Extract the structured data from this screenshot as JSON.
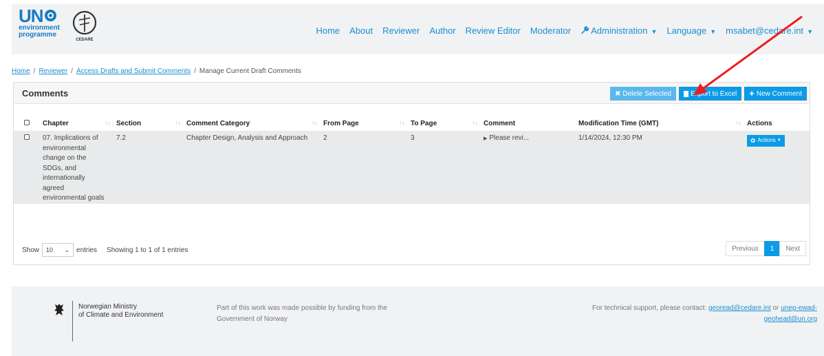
{
  "header": {
    "logo": {
      "un": "UN",
      "line1": "environment",
      "line2": "programme",
      "cedare": "CEDARE"
    },
    "nav": [
      {
        "label": "Home"
      },
      {
        "label": "About"
      },
      {
        "label": "Reviewer"
      },
      {
        "label": "Author"
      },
      {
        "label": "Review Editor"
      },
      {
        "label": "Moderator"
      },
      {
        "label": "Administration",
        "icon": "wrench-icon",
        "dropdown": true
      },
      {
        "label": "Language",
        "dropdown": true
      },
      {
        "label": "msabet@cedare.int",
        "dropdown": true
      }
    ]
  },
  "breadcrumb": {
    "items": [
      "Home",
      "Reviewer",
      "Access Drafts and Submit Comments"
    ],
    "current": "Manage Current Draft Comments",
    "separator": "/"
  },
  "panel": {
    "title": "Comments",
    "buttons": {
      "delete": "Delete Selected",
      "export": "Export to Excel",
      "new": "New Comment"
    },
    "columns": [
      "Chapter",
      "Section",
      "Comment Category",
      "From Page",
      "To Page",
      "Comment",
      "Modification Time (GMT)",
      "Actions"
    ],
    "rows": [
      {
        "chapter": "07. Implications of environmental change on the SDGs, and internationally agreed environmental goals",
        "section": "7.2",
        "category": "Chapter Design, Analysis and Approach",
        "from_page": "2",
        "to_page": "3",
        "comment": "Please revi...",
        "modified": "1/14/2024, 12:30 PM",
        "action": "Actions"
      }
    ],
    "show_label": "Show",
    "entries_value": "10",
    "entries_label": "entries",
    "info": "Showing 1 to 1 of 1 entries",
    "pager": {
      "prev": "Previous",
      "current": "1",
      "next": "Next"
    }
  },
  "footer": {
    "ministry": "Norwegian Ministry\nof Climate and Environment",
    "funding": "Part of this work was made possible by funding from the Government of Norway",
    "support_text": "For technical support, please contact:",
    "email1": "georead@cedare.int",
    "or": "or",
    "email2": "unep-ewad-geohead@un.org"
  },
  "colors": {
    "link": "#1a8ed1",
    "primary_button": "#0c9be6",
    "annotation_arrow": "#ee1c1c"
  }
}
